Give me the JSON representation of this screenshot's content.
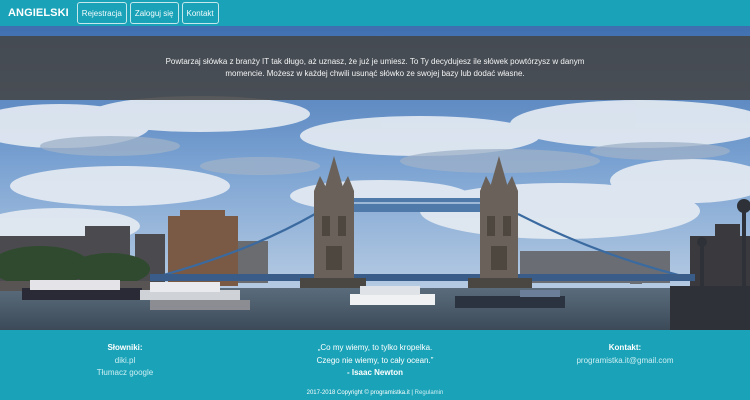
{
  "navbar": {
    "brand": "ANGIELSKI",
    "links": [
      "Rejestracja",
      "Zaloguj się",
      "Kontakt"
    ]
  },
  "hero": {
    "intro": "Powtarzaj słówka z branży IT tak długo, aż uznasz, że już je umiesz. To Ty decydujesz ile słówek powtórzysz w danym momencie. Możesz w każdej chwili usunąć słówko ze swojej bazy lub dodać własne.",
    "image_subject": "Tower Bridge, London"
  },
  "footer": {
    "dictionaries": {
      "heading": "Słowniki:",
      "links": [
        "diki.pl",
        "Tłumacz google"
      ]
    },
    "quote": {
      "line1": "„Co my wiemy, to tylko kropelka.",
      "line2": "Czego nie wiemy, to cały ocean.”",
      "author": "- Isaac Newton"
    },
    "contact": {
      "heading": "Kontakt:",
      "email": "programistka.it@gmail.com"
    },
    "copyright": {
      "text": "2017-2018 Copyright © programistka.it |",
      "regulations": "Regulamin"
    }
  },
  "colors": {
    "primary": "#1aa3b8",
    "overlay": "#464646",
    "link": "#cdeef3"
  }
}
